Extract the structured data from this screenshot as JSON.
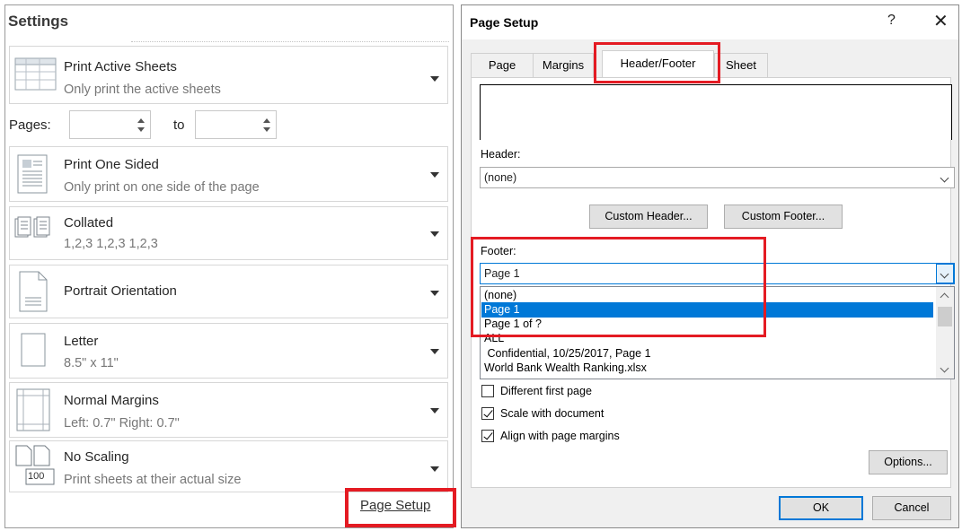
{
  "settings": {
    "title": "Settings",
    "print_what": {
      "title": "Print Active Sheets",
      "subtitle": "Only print the active sheets"
    },
    "pages": {
      "label": "Pages:",
      "to_label": "to",
      "from_value": "",
      "to_value": ""
    },
    "sides": {
      "title": "Print One Sided",
      "subtitle": "Only print on one side of the page"
    },
    "collation": {
      "title": "Collated",
      "subtitle": "1,2,3   1,2,3   1,2,3"
    },
    "orientation": {
      "title": "Portrait Orientation"
    },
    "paper": {
      "title": "Letter",
      "subtitle": "8.5\" x 11\""
    },
    "margins": {
      "title": "Normal Margins",
      "subtitle": "Left:  0.7\"    Right:  0.7\""
    },
    "scaling": {
      "title": "No Scaling",
      "subtitle": "Print sheets at their actual size",
      "icon_text": "100"
    },
    "page_setup_link": "Page Setup"
  },
  "dialog": {
    "title": "Page Setup",
    "help": "?",
    "close": "✕",
    "tabs": [
      "Page",
      "Margins",
      "Header/Footer",
      "Sheet"
    ],
    "header_label": "Header:",
    "header_value": "(none)",
    "custom_header_label": "Custom Header...",
    "custom_footer_label": "Custom Footer...",
    "footer_label": "Footer:",
    "footer_value": "Page 1",
    "footer_options": [
      "(none)",
      "Page 1",
      "Page 1 of ?",
      "ALL",
      " Confidential, 10/25/2017, Page 1",
      "World Bank Wealth Ranking.xlsx"
    ],
    "selected_footer_index": 1,
    "checkboxes": [
      {
        "label": "Different first page",
        "checked": false
      },
      {
        "label": "Scale with document",
        "checked": true
      },
      {
        "label": "Align with page margins",
        "checked": true
      }
    ],
    "options_label": "Options...",
    "ok_label": "OK",
    "cancel_label": "Cancel"
  },
  "colors": {
    "highlight_red": "#e41b23",
    "selection_blue": "#0078d7"
  }
}
